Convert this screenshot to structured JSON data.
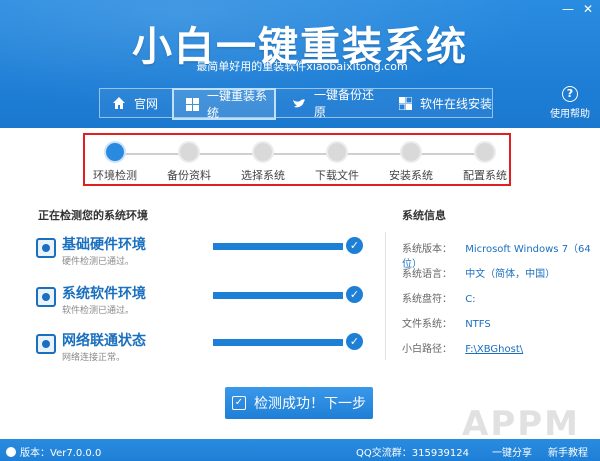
{
  "app": {
    "title": "小白一键重装系统",
    "subtitle": "最简单好用的重装软件xiaobaixitong.com",
    "window_buttons": [
      "—",
      "✕"
    ]
  },
  "nav": {
    "items": [
      {
        "label": "官网",
        "icon": "home-icon"
      },
      {
        "label": "一键重装系统",
        "icon": "windows-icon",
        "active": true
      },
      {
        "label": "一键备份还原",
        "icon": "bird-icon"
      },
      {
        "label": "软件在线安装",
        "icon": "grid-icon"
      }
    ]
  },
  "help": {
    "label": "使用帮助"
  },
  "steps": [
    {
      "label": "环境检测",
      "active": true
    },
    {
      "label": "备份资料",
      "active": false
    },
    {
      "label": "选择系统",
      "active": false
    },
    {
      "label": "下载文件",
      "active": false
    },
    {
      "label": "安装系统",
      "active": false
    },
    {
      "label": "配置系统",
      "active": false
    }
  ],
  "checks": {
    "title": "正在检测您的系统环境",
    "items": [
      {
        "name": "基础硬件环境",
        "desc": "硬件检测已通过。",
        "progress": 1.0
      },
      {
        "name": "系统软件环境",
        "desc": "软件检测已通过。",
        "progress": 1.0
      },
      {
        "name": "网络联通状态",
        "desc": "网络连接正常。",
        "progress": 1.0
      }
    ]
  },
  "sysinfo": {
    "title": "系统信息",
    "rows": [
      {
        "key": "系统版本：",
        "value": "Microsoft Windows 7（64位）"
      },
      {
        "key": "系统语言：",
        "value": "中文（简体，中国）"
      },
      {
        "key": "系统盘符：",
        "value": "C:"
      },
      {
        "key": "文件系统：",
        "value": "NTFS"
      },
      {
        "key": "小白路径：",
        "value": "F:\\XBGhost\\"
      }
    ]
  },
  "next_button": {
    "label": "检测成功！下一步"
  },
  "footer": {
    "version": "版本：Ver7.0.0.0",
    "qq": "QQ交流群：315939124",
    "share": "一键分享",
    "tutorial": "新手教程",
    "watermark": "APPM"
  },
  "colors": {
    "brand": "#1e7fd6",
    "step_active": "#2a8ae0",
    "highlight_border": "#e02020"
  }
}
